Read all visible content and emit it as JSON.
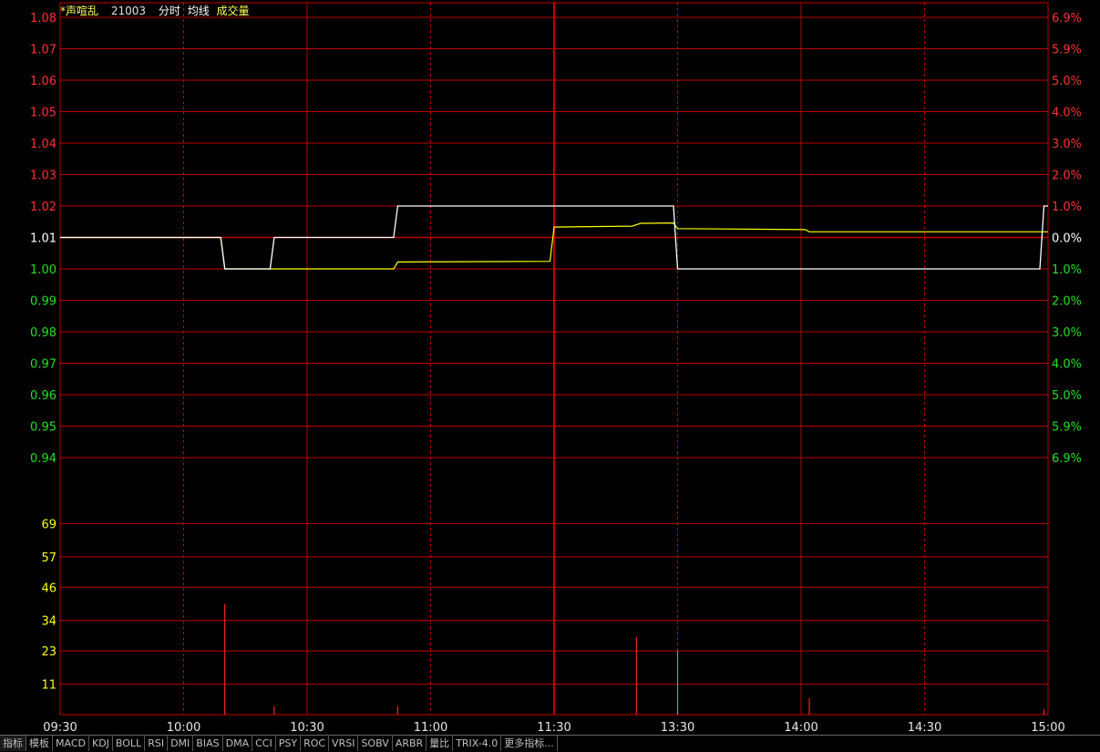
{
  "header": {
    "name": "*声喧乱",
    "code": "21003",
    "label_time": "分时",
    "label_avg": "均线",
    "label_vol": "成交量"
  },
  "colors": {
    "grid": "#c00000",
    "price_line": "#ffffff",
    "avg_line": "#ffff00",
    "up": "#ff3030",
    "down": "#22e022",
    "flat": "#ffffff",
    "vol_label": "#ffff00",
    "vol_bar_up": "#ff2020",
    "vol_bar_down": "#00c0c0"
  },
  "chart_data": {
    "type": "line",
    "prev_close": 1.01,
    "price_ticks": [
      "1.08",
      "1.07",
      "1.06",
      "1.05",
      "1.04",
      "1.03",
      "1.02",
      "1.01",
      "1.00",
      "0.99",
      "0.98",
      "0.97",
      "0.96",
      "0.95",
      "0.94"
    ],
    "pct_ticks": [
      "6.9%",
      "5.9%",
      "5.0%",
      "4.0%",
      "3.0%",
      "2.0%",
      "1.0%",
      "0.0%",
      "1.0%",
      "2.0%",
      "3.0%",
      "4.0%",
      "5.0%",
      "5.9%",
      "6.9%"
    ],
    "price_range": [
      0.94,
      1.08
    ],
    "volume_ticks": [
      "69",
      "57",
      "46",
      "34",
      "23",
      "11"
    ],
    "volume_range": [
      0,
      80
    ],
    "x_ticks": [
      "09:30",
      "10:00",
      "10:30",
      "11:00",
      "11:30",
      "13:30",
      "14:00",
      "14:30",
      "15:00"
    ],
    "minutes_total": 240,
    "price_series": [
      {
        "t": 0,
        "v": 1.01
      },
      {
        "t": 39,
        "v": 1.01
      },
      {
        "t": 40,
        "v": 1.0
      },
      {
        "t": 51,
        "v": 1.0
      },
      {
        "t": 52,
        "v": 1.01
      },
      {
        "t": 81,
        "v": 1.01
      },
      {
        "t": 82,
        "v": 1.02
      },
      {
        "t": 120,
        "v": 1.02
      },
      {
        "t": 149,
        "v": 1.02
      },
      {
        "t": 150,
        "v": 1.0
      },
      {
        "t": 238,
        "v": 1.0
      },
      {
        "t": 239,
        "v": 1.02
      },
      {
        "t": 240,
        "v": 1.02
      }
    ],
    "avg_series": [
      {
        "t": 0,
        "v": 1.01
      },
      {
        "t": 39,
        "v": 1.01
      },
      {
        "t": 40,
        "v": 1.0
      },
      {
        "t": 52,
        "v": 1.0
      },
      {
        "t": 81,
        "v": 1.0
      },
      {
        "t": 82,
        "v": 1.0022
      },
      {
        "t": 119,
        "v": 1.0024
      },
      {
        "t": 120,
        "v": 1.0133
      },
      {
        "t": 139,
        "v": 1.0136
      },
      {
        "t": 141,
        "v": 1.0145
      },
      {
        "t": 149,
        "v": 1.0146
      },
      {
        "t": 150,
        "v": 1.0128
      },
      {
        "t": 181,
        "v": 1.0125
      },
      {
        "t": 182,
        "v": 1.0118
      },
      {
        "t": 240,
        "v": 1.0118
      }
    ],
    "volume_bars": [
      {
        "t": 40,
        "v": 40,
        "dir": "up"
      },
      {
        "t": 52,
        "v": 3,
        "dir": "up"
      },
      {
        "t": 82,
        "v": 3,
        "dir": "up"
      },
      {
        "t": 140,
        "v": 28,
        "dir": "up"
      },
      {
        "t": 150,
        "v": 23,
        "dir": "down"
      },
      {
        "t": 182,
        "v": 6,
        "dir": "up"
      },
      {
        "t": 239,
        "v": 2,
        "dir": "up"
      }
    ]
  },
  "tabs": [
    "指标",
    "模板",
    "MACD",
    "KDJ",
    "BOLL",
    "RSI",
    "DMI",
    "BIAS",
    "DMA",
    "CCI",
    "PSY",
    "ROC",
    "VRSI",
    "SOBV",
    "ARBR",
    "量比",
    "TRIX-4.0",
    "更多指标..."
  ]
}
